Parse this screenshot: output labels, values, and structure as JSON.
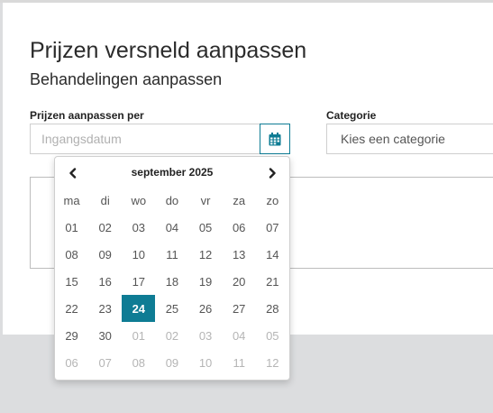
{
  "page": {
    "title": "Prijzen versneld aanpassen",
    "subtitle": "Behandelingen aanpassen"
  },
  "form": {
    "prices_label": "Prijzen aanpassen per",
    "date_placeholder": "Ingangsdatum",
    "date_button_icon": "calendar-icon",
    "category_label": "Categorie",
    "category_value": "Kies een categorie"
  },
  "datepicker": {
    "month_label": "september 2025",
    "prev_icon": "chevron-left-icon",
    "next_icon": "chevron-right-icon",
    "weekdays": [
      "ma",
      "di",
      "wo",
      "do",
      "vr",
      "za",
      "zo"
    ],
    "selected_day": "24",
    "weeks": [
      [
        {
          "d": "01",
          "m": false
        },
        {
          "d": "02",
          "m": false
        },
        {
          "d": "03",
          "m": false
        },
        {
          "d": "04",
          "m": false
        },
        {
          "d": "05",
          "m": false
        },
        {
          "d": "06",
          "m": false
        },
        {
          "d": "07",
          "m": false
        }
      ],
      [
        {
          "d": "08",
          "m": false
        },
        {
          "d": "09",
          "m": false
        },
        {
          "d": "10",
          "m": false
        },
        {
          "d": "11",
          "m": false
        },
        {
          "d": "12",
          "m": false
        },
        {
          "d": "13",
          "m": false
        },
        {
          "d": "14",
          "m": false
        }
      ],
      [
        {
          "d": "15",
          "m": false
        },
        {
          "d": "16",
          "m": false
        },
        {
          "d": "17",
          "m": false
        },
        {
          "d": "18",
          "m": false
        },
        {
          "d": "19",
          "m": false
        },
        {
          "d": "20",
          "m": false
        },
        {
          "d": "21",
          "m": false
        }
      ],
      [
        {
          "d": "22",
          "m": false
        },
        {
          "d": "23",
          "m": false
        },
        {
          "d": "24",
          "m": false,
          "s": true
        },
        {
          "d": "25",
          "m": false
        },
        {
          "d": "26",
          "m": false
        },
        {
          "d": "27",
          "m": false
        },
        {
          "d": "28",
          "m": false
        }
      ],
      [
        {
          "d": "29",
          "m": false
        },
        {
          "d": "30",
          "m": false
        },
        {
          "d": "01",
          "m": true
        },
        {
          "d": "02",
          "m": true
        },
        {
          "d": "03",
          "m": true
        },
        {
          "d": "04",
          "m": true
        },
        {
          "d": "05",
          "m": true
        }
      ],
      [
        {
          "d": "06",
          "m": true
        },
        {
          "d": "07",
          "m": true
        },
        {
          "d": "08",
          "m": true
        },
        {
          "d": "09",
          "m": true
        },
        {
          "d": "10",
          "m": true
        },
        {
          "d": "11",
          "m": true
        },
        {
          "d": "12",
          "m": true
        }
      ]
    ]
  },
  "colors": {
    "accent": "#0e7c94",
    "background": "#dcdddf",
    "panel": "#ffffff"
  }
}
